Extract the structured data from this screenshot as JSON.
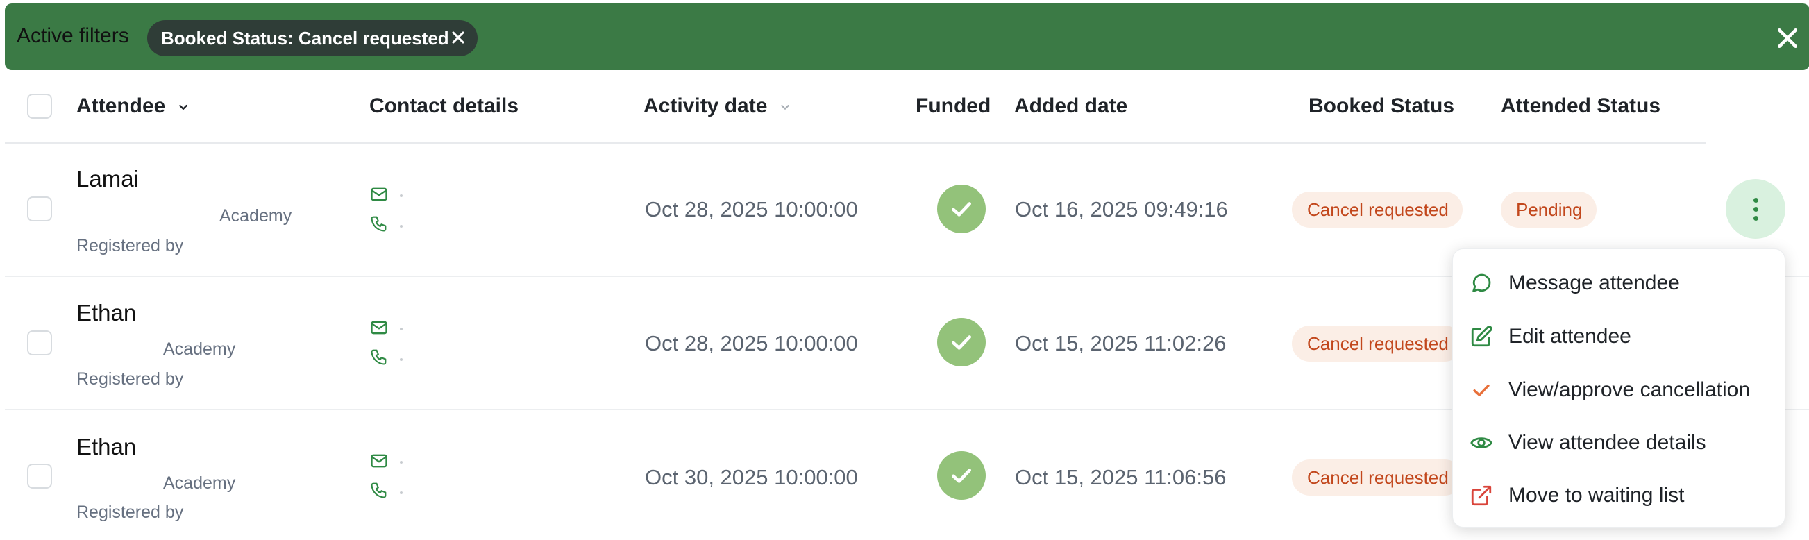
{
  "filters": {
    "title": "Active filters",
    "chip_label": "Booked Status: Cancel requested"
  },
  "table": {
    "columns": [
      "Attendee",
      "Contact details",
      "Activity date",
      "Funded",
      "Added date",
      "Booked Status",
      "Attended Status"
    ],
    "rows": [
      {
        "name": "Lamai",
        "organization": "Academy",
        "registered_by": "Registered by",
        "activity_date": "Oct 28, 2025 10:00:00",
        "funded": true,
        "added_date": "Oct 16, 2025 09:49:16",
        "booked_status": "Cancel requested",
        "attended_status": "Pending"
      },
      {
        "name": "Ethan",
        "organization": "Academy",
        "registered_by": "Registered by",
        "activity_date": "Oct 28, 2025 10:00:00",
        "funded": true,
        "added_date": "Oct 15, 2025 11:02:26",
        "booked_status": "Cancel requested",
        "attended_status": ""
      },
      {
        "name": "Ethan",
        "organization": "Academy",
        "registered_by": "Registered by",
        "activity_date": "Oct 30, 2025 10:00:00",
        "funded": true,
        "added_date": "Oct 15, 2025 11:06:56",
        "booked_status": "Cancel requested",
        "attended_status": ""
      }
    ]
  },
  "menu": {
    "items": [
      {
        "label": "Message attendee",
        "icon": "message-icon",
        "color": "#2f8a44"
      },
      {
        "label": "Edit attendee",
        "icon": "edit-icon",
        "color": "#2f8a44"
      },
      {
        "label": "View/approve cancellation",
        "icon": "check-icon",
        "color": "#e8703a"
      },
      {
        "label": "View attendee details",
        "icon": "eye-icon",
        "color": "#2f8a44"
      },
      {
        "label": "Move to waiting list",
        "icon": "external-link-icon",
        "color": "#d9443a"
      }
    ]
  },
  "colors": {
    "filter_bar": "#3b7a45",
    "chip": "#2f3d37",
    "accent_green": "#2f8a44",
    "badge_bg": "#fbeee6",
    "badge_text": "#c2471c",
    "funded": "#93c27a"
  }
}
